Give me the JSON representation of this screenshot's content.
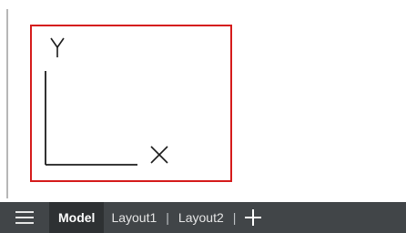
{
  "canvas": {
    "ucs": {
      "y_label": "Y",
      "x_label": "X"
    },
    "selection_box_color": "#d51b1b"
  },
  "tabbar": {
    "menu_icon": "hamburger-icon",
    "tabs": [
      {
        "label": "Model",
        "active": true
      },
      {
        "label": "Layout1",
        "active": false
      },
      {
        "label": "Layout2",
        "active": false
      }
    ],
    "separator": "|",
    "add_icon": "plus-icon"
  }
}
